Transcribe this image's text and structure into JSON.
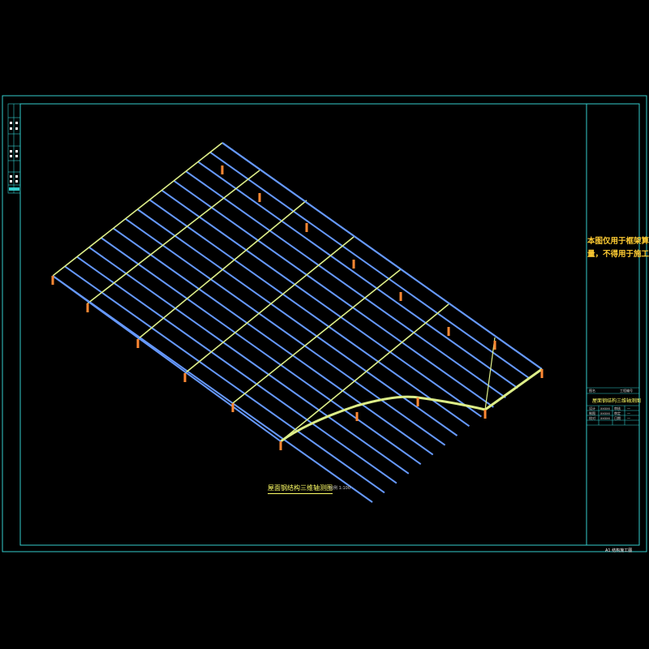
{
  "drawing": {
    "caption": "屋面钢结构三维轴测图",
    "caption_scale": "比例 1:100",
    "note": [
      "本图仅用于框架算",
      "量，不得用于施工"
    ],
    "titleblock": {
      "project_title": "屋面钢结构三维轴测图",
      "head_left": "图名",
      "head_right": "工程编号",
      "rows": [
        {
          "a": "设计",
          "b": "xxxxx",
          "c": "审核",
          "d": "—"
        },
        {
          "a": "制图",
          "b": "xxxxx",
          "c": "审定",
          "d": "—"
        },
        {
          "a": "校对",
          "b": "xxxxx",
          "c": "日期",
          "d": "—"
        }
      ],
      "sheet_no": "A1 结构施工图"
    }
  },
  "colors": {
    "frame": "#33cccc",
    "purlin": "#6699ff",
    "rafter": "#ddee88",
    "column": "#ff8833",
    "note_text": "#ffcc33"
  }
}
